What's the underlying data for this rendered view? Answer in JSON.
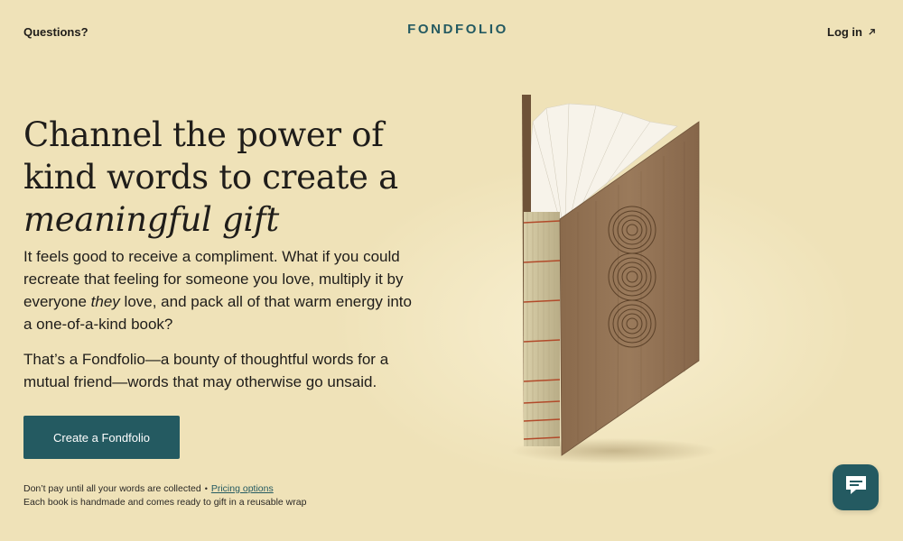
{
  "header": {
    "questions_label": "Questions?",
    "logo_text": "FONDFOLIO",
    "login_label": "Log in",
    "login_icon": "arrow-up-right-icon"
  },
  "hero": {
    "headline_line1": "Channel the power of",
    "headline_line2": "kind words to create a",
    "headline_italic": "meaningful gift",
    "lead_part1": "It feels good to receive a compliment. What if you could recreate that feeling for someone you love, multiply it by everyone ",
    "lead_emphasis": "they",
    "lead_part2": " love, and pack all of that warm energy into a one-of-a-kind book?",
    "lead2": "That’s a Fondfolio—a bounty of thoughtful words for a mutual friend—words that may otherwise go unsaid.",
    "cta_label": "Create a Fondfolio",
    "fineprint_line1": "Don’t pay until all your words are collected",
    "fineprint_sep": "•",
    "pricing_link": "Pricing options",
    "fineprint_line2": "Each book is handmade and comes ready to gift in a reusable wrap"
  },
  "chat": {
    "icon": "chat-bubble-icon"
  },
  "colors": {
    "background": "#efe2b8",
    "accent": "#245a61",
    "text": "#1f1d1a"
  }
}
